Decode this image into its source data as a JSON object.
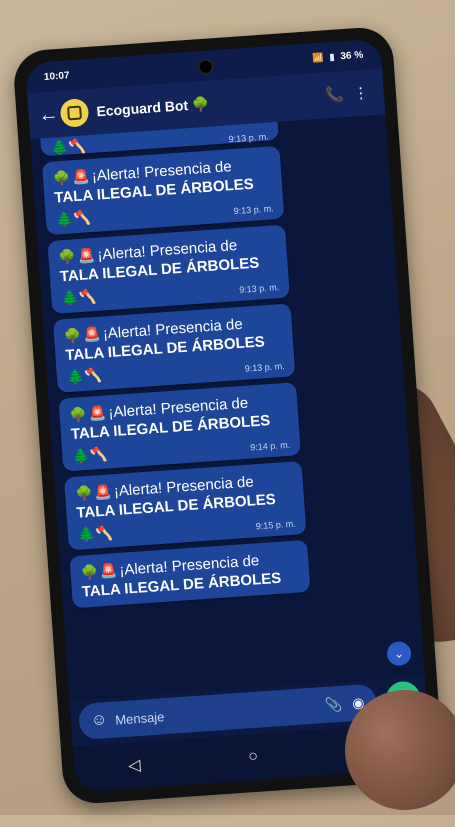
{
  "status_bar": {
    "time": "10:07",
    "battery": "36 %"
  },
  "header": {
    "title": "Ecoguard Bot",
    "title_emoji": "🌳",
    "back_icon": "back-arrow-icon",
    "call_icon": "add-call-icon",
    "menu_icon": "more-vert-icon"
  },
  "messages": [
    {
      "partial": true,
      "emojis": "🌲🪓",
      "time": "9:13 p. m."
    },
    {
      "line1": "¡Alerta! Presencia de",
      "line2": "TALA ILEGAL DE ÁRBOLES",
      "emojis": "🌲🪓",
      "time": "9:13 p. m."
    },
    {
      "line1": "¡Alerta! Presencia de",
      "line2": "TALA ILEGAL DE ÁRBOLES",
      "emojis": "🌲🪓",
      "time": "9:13 p. m."
    },
    {
      "line1": "¡Alerta! Presencia de",
      "line2": "TALA ILEGAL DE ÁRBOLES",
      "emojis": "🌲🪓",
      "time": "9:13 p. m."
    },
    {
      "line1": "¡Alerta! Presencia de",
      "line2": "TALA ILEGAL DE ÁRBOLES",
      "emojis": "🌲🪓",
      "time": "9:14 p. m."
    },
    {
      "line1": "¡Alerta! Presencia de",
      "line2": "TALA ILEGAL DE ÁRBOLES",
      "emojis": "🌲🪓",
      "time": "9:15 p. m."
    },
    {
      "line1": "¡Alerta! Presencia de",
      "line2": "TALA ILEGAL DE ÁRBOLES",
      "emojis": "",
      "time": ""
    }
  ],
  "input": {
    "placeholder": "Mensaje"
  },
  "colors": {
    "bubble": "#1d4599",
    "chat_bg": "#0a173a",
    "header": "#12245a",
    "send": "#26c281"
  }
}
